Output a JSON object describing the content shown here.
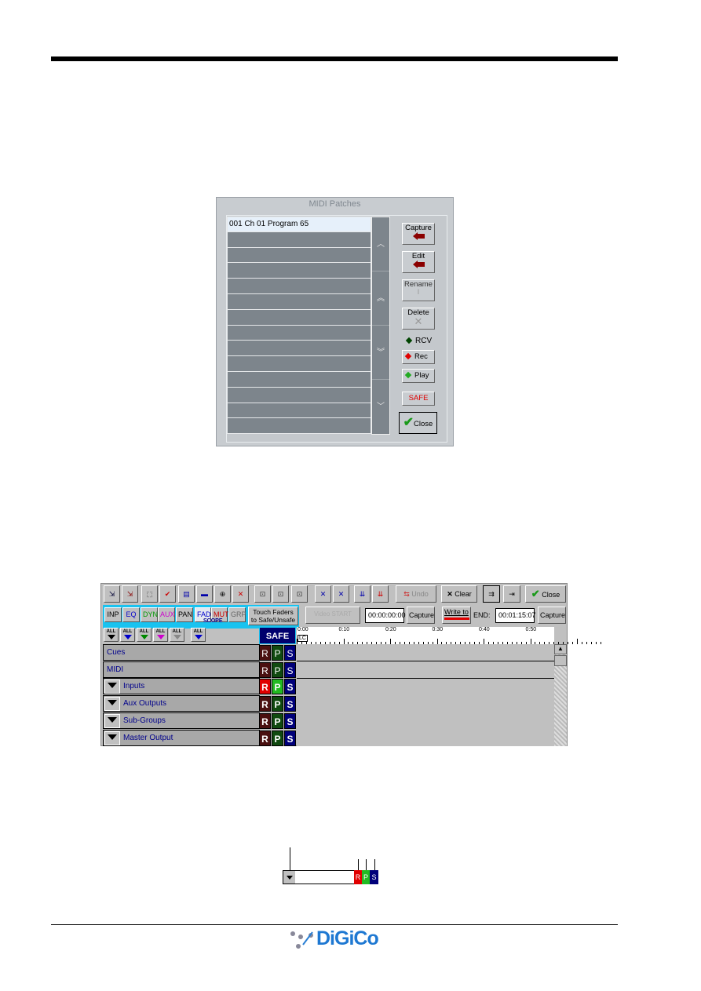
{
  "midi_dialog": {
    "title": "MIDI Patches",
    "patches": [
      "001   Ch 01 Program 65",
      "",
      "",
      "",
      "",
      "",
      "",
      "",
      "",
      "",
      "",
      "",
      "",
      ""
    ],
    "buttons": {
      "capture": "Capture",
      "edit": "Edit",
      "rename": "Rename",
      "delete": "Delete",
      "rcv": "RCV",
      "rec": "Rec",
      "play": "Play",
      "safe": "SAFE",
      "close": "Close"
    },
    "safe_color": "#e00000"
  },
  "automation": {
    "toolbar": {
      "undo": "Undo",
      "clear": "Clear",
      "close": "Close"
    },
    "filters": [
      "INP",
      "EQ",
      "DYN",
      "AUX",
      "PAN",
      "FAD",
      "MUT",
      "GRP"
    ],
    "filter_colors": [
      "#000000",
      "#0000cc",
      "#009900",
      "#cc00cc",
      "#000000",
      "#0000cc",
      "#cc0000",
      "#666666"
    ],
    "touch_faders": [
      "Touch Faders",
      "to Safe/Unsafe"
    ],
    "video_start": "Video START",
    "start_time": "00:00:00:00",
    "capture": "Capture",
    "write_to": "Write to",
    "end_label": "END:",
    "end_time": "00:01:15:07",
    "all_label": "ALL",
    "scope": "SCOPE",
    "safe": "SAFE",
    "lc": "LC",
    "ticks": [
      "0:00",
      "0:10",
      "0:20",
      "0:30",
      "0:40",
      "0:50"
    ],
    "rows": [
      {
        "label": "Cues",
        "dropdown": false
      },
      {
        "label": "MIDI",
        "dropdown": false
      },
      {
        "label": "Inputs",
        "dropdown": true
      },
      {
        "label": "Aux Outputs",
        "dropdown": true
      },
      {
        "label": "Sub-Groups",
        "dropdown": true
      },
      {
        "label": "Master Output",
        "dropdown": true
      }
    ],
    "rps": {
      "r": "R",
      "p": "P",
      "s": "S"
    }
  },
  "legend_diagram": {
    "r": "R",
    "p": "P",
    "s": "S"
  },
  "footer": {
    "logo": "DiGiCo"
  }
}
